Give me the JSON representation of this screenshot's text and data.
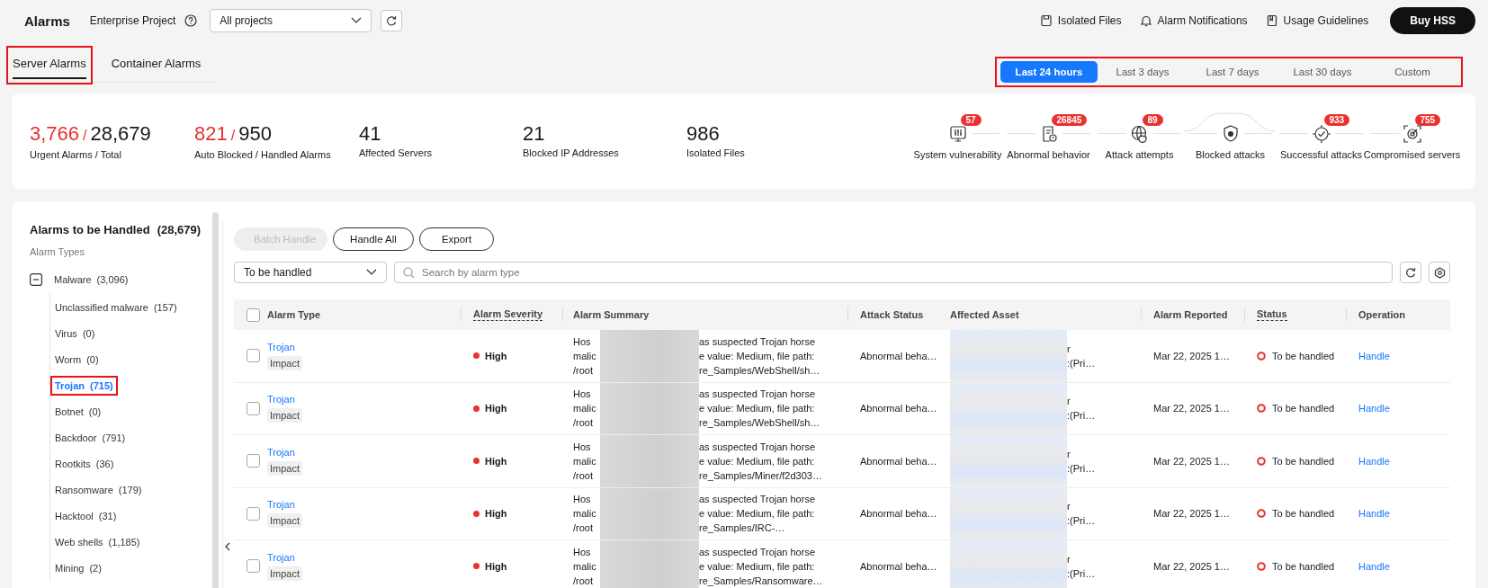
{
  "header": {
    "title": "Alarms",
    "project_label": "Enterprise Project",
    "project_select": {
      "value": "All projects"
    },
    "links": [
      {
        "kind": "file",
        "label": "Isolated Files"
      },
      {
        "kind": "bell",
        "label": "Alarm Notifications"
      },
      {
        "kind": "book",
        "label": "Usage Guidelines"
      }
    ],
    "buy_button": "Buy HSS"
  },
  "tabs": [
    {
      "label": "Server Alarms",
      "selected": true,
      "highlighted": true
    },
    {
      "label": "Container Alarms",
      "selected": false,
      "highlighted": false
    }
  ],
  "time_range": {
    "highlighted": true,
    "options": [
      {
        "label": "Last 24 hours",
        "selected": true
      },
      {
        "label": "Last 3 days",
        "selected": false
      },
      {
        "label": "Last 7 days",
        "selected": false
      },
      {
        "label": "Last 30 days",
        "selected": false
      },
      {
        "label": "Custom",
        "selected": false
      }
    ]
  },
  "stats": [
    {
      "kind": "ratio",
      "value": "3,766",
      "separator": "/",
      "total": "28,679",
      "label": "Urgent Alarms  / Total"
    },
    {
      "kind": "ratio",
      "value": "821",
      "separator": "/",
      "total": "950",
      "label": "Auto Blocked  / Handled Alarms"
    },
    {
      "kind": "single",
      "value": "41",
      "label": "Affected Servers"
    },
    {
      "kind": "single",
      "value": "21",
      "label": "Blocked IP Addresses"
    },
    {
      "kind": "single",
      "value": "986",
      "label": "Isolated Files"
    }
  ],
  "attack_chain": [
    {
      "kind": "vuln",
      "badge": "57",
      "label": "System vulnerability"
    },
    {
      "kind": "doc",
      "badge": "26845",
      "label": "Abnormal behavior"
    },
    {
      "kind": "globe",
      "badge": "89",
      "label": "Attack attempts"
    },
    {
      "kind": "shield",
      "label": "Blocked attacks"
    },
    {
      "kind": "target",
      "badge": "933",
      "label": "Successful attacks"
    },
    {
      "kind": "server",
      "badge": "755",
      "label": "Compromised servers"
    }
  ],
  "sidebar": {
    "title": "Alarms to be Handled",
    "count": "(28,679)",
    "subtitle": "Alarm Types",
    "tree": [
      {
        "label": "Malware",
        "count": "(3,096)",
        "expanded": true,
        "selected": false,
        "children": [
          {
            "label": "Unclassified malware",
            "count": "(157)",
            "selected": false,
            "highlighted": false
          },
          {
            "label": "Virus",
            "count": "(0)",
            "selected": false,
            "highlighted": false
          },
          {
            "label": "Worm",
            "count": "(0)",
            "selected": false,
            "highlighted": false
          },
          {
            "label": "Trojan",
            "count": "(715)",
            "selected": true,
            "highlighted": true
          },
          {
            "label": "Botnet",
            "count": "(0)",
            "selected": false,
            "highlighted": false
          },
          {
            "label": "Backdoor",
            "count": "(791)",
            "selected": false,
            "highlighted": false
          },
          {
            "label": "Rootkits",
            "count": "(36)",
            "selected": false,
            "highlighted": false
          },
          {
            "label": "Ransomware",
            "count": "(179)",
            "selected": false,
            "highlighted": false
          },
          {
            "label": "Hacktool",
            "count": "(31)",
            "selected": false,
            "highlighted": false
          },
          {
            "label": "Web shells",
            "count": "(1,185)",
            "selected": false,
            "highlighted": false
          },
          {
            "label": "Mining",
            "count": "(2)",
            "selected": false,
            "highlighted": false
          }
        ]
      }
    ]
  },
  "toolbar": {
    "buttons": [
      {
        "label": "Batch Handle",
        "disabled": true
      },
      {
        "label": "Handle All",
        "disabled": false
      },
      {
        "label": "Export",
        "disabled": false
      }
    ],
    "status_filter": {
      "value": "To be handled"
    },
    "search": {
      "placeholder": "Search by alarm type"
    }
  },
  "table": {
    "header_checked": false,
    "columns": [
      {
        "label": "Alarm Type",
        "tooltip": false
      },
      {
        "label": "Alarm Severity",
        "tooltip": true
      },
      {
        "label": "Alarm Summary",
        "tooltip": false
      },
      {
        "label": "Attack Status",
        "tooltip": false
      },
      {
        "label": "Affected Asset",
        "tooltip": false
      },
      {
        "label": "Alarm Reported",
        "tooltip": false
      },
      {
        "label": "Status",
        "tooltip": true
      },
      {
        "label": "Operation",
        "tooltip": false
      }
    ],
    "rows": [
      {
        "checked": false,
        "type": "Trojan",
        "tag": "Impact",
        "severity": {
          "label": "High",
          "color": "#e8322f"
        },
        "summary_left": [
          "Hos",
          "malic",
          "/root"
        ],
        "summary_right": [
          "as suspected Trojan horse",
          "e value: Medium, file path:",
          "re_Samples/WebShell/sh…"
        ],
        "attack_status": "Abnormal beha…",
        "asset": [
          "r",
          ":(Pri…"
        ],
        "reported": "Mar 22, 2025 1…",
        "status": "To be handled",
        "operation": "Handle"
      },
      {
        "checked": false,
        "type": "Trojan",
        "tag": "Impact",
        "severity": {
          "label": "High",
          "color": "#e8322f"
        },
        "summary_left": [
          "Hos",
          "malic",
          "/root"
        ],
        "summary_right": [
          "as suspected Trojan horse",
          "e value: Medium, file path:",
          "re_Samples/WebShell/sh…"
        ],
        "attack_status": "Abnormal beha…",
        "asset": [
          "r",
          ":(Pri…"
        ],
        "reported": "Mar 22, 2025 1…",
        "status": "To be handled",
        "operation": "Handle"
      },
      {
        "checked": false,
        "type": "Trojan",
        "tag": "Impact",
        "severity": {
          "label": "High",
          "color": "#e8322f"
        },
        "summary_left": [
          "Hos",
          "malic",
          "/root"
        ],
        "summary_right": [
          "as suspected Trojan horse",
          "e value: Medium, file path:",
          "re_Samples/Miner/f2d303…"
        ],
        "attack_status": "Abnormal beha…",
        "asset": [
          "r",
          ":(Pri…"
        ],
        "reported": "Mar 22, 2025 1…",
        "status": "To be handled",
        "operation": "Handle"
      },
      {
        "checked": false,
        "type": "Trojan",
        "tag": "Impact",
        "severity": {
          "label": "High",
          "color": "#e8322f"
        },
        "summary_left": [
          "Hos",
          "malic",
          "/root"
        ],
        "summary_right": [
          "as suspected Trojan horse",
          "e value: Medium, file path:",
          "re_Samples/IRC-…"
        ],
        "attack_status": "Abnormal beha…",
        "asset": [
          "r",
          ":(Pri…"
        ],
        "reported": "Mar 22, 2025 1…",
        "status": "To be handled",
        "operation": "Handle"
      },
      {
        "checked": false,
        "type": "Trojan",
        "tag": "Impact",
        "severity": {
          "label": "High",
          "color": "#e8322f"
        },
        "summary_left": [
          "Hos",
          "malic",
          "/root"
        ],
        "summary_right": [
          "as suspected Trojan horse",
          "e value: Medium, file path:",
          "re_Samples/Ransomware…"
        ],
        "attack_status": "Abnormal beha…",
        "asset": [
          "r",
          ":(Pri…"
        ],
        "reported": "Mar 22, 2025 1…",
        "status": "To be handled",
        "operation": "Handle"
      }
    ]
  }
}
